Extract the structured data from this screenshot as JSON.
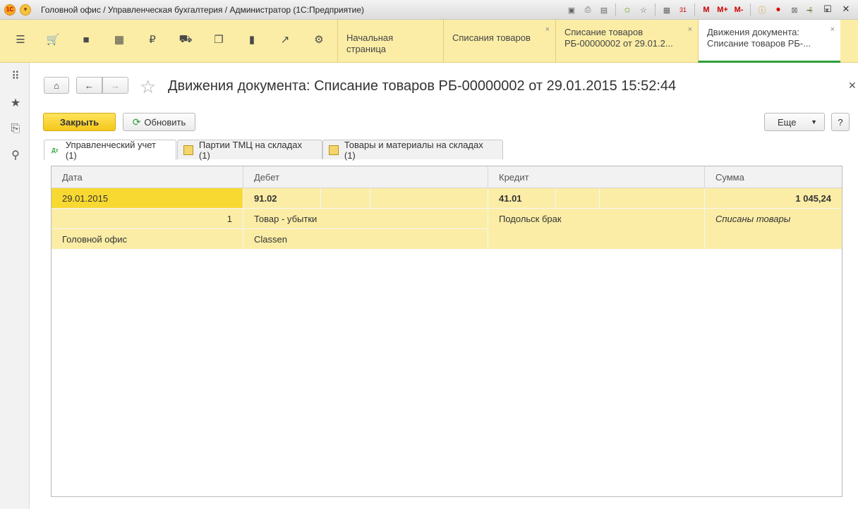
{
  "window": {
    "title": "Головной офис / Управленческая бухгалтерия / Администратор  (1С:Предприятие)",
    "logo_text": "1С",
    "tools": [
      "M",
      "M+",
      "M-"
    ]
  },
  "open_tabs": [
    {
      "label_line1": "Начальная страница",
      "label_line2": ""
    },
    {
      "label_line1": "Списания товаров",
      "label_line2": ""
    },
    {
      "label_line1": "Списание товаров",
      "label_line2": "РБ-00000002 от 29.01.2..."
    },
    {
      "label_line1": "Движения документа:",
      "label_line2": "Списание товаров РБ-..."
    }
  ],
  "form": {
    "title": "Движения документа: Списание товаров РБ-00000002 от 29.01.2015 15:52:44",
    "close_button": "Закрыть",
    "refresh_button": "Обновить",
    "more_button": "Еще",
    "help_button": "?"
  },
  "inner_tabs": [
    {
      "label": "Управленческий учет (1)",
      "icon": "dt-kt-icon"
    },
    {
      "label": "Партии ТМЦ на складах (1)",
      "icon": "register-icon"
    },
    {
      "label": "Товары и материалы на складах (1)",
      "icon": "register-icon"
    }
  ],
  "table": {
    "headers": [
      "Дата",
      "Дебет",
      "Кредит",
      "Сумма"
    ],
    "row": {
      "date": "29.01.2015",
      "debit_account": "91.02",
      "credit_account": "41.01",
      "sum": "1 045,24",
      "line_number": "1",
      "debit_subconto1": "Товар - убытки",
      "credit_subconto1": "Подольск брак",
      "content": "Списаны товары",
      "organization": "Головной офис",
      "debit_subconto2": "Classen"
    }
  }
}
